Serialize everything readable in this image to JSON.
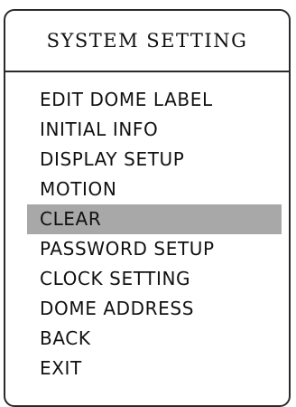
{
  "menu": {
    "title": "SYSTEM SETTING",
    "selected_item": "CLEAR",
    "items": [
      {
        "label": "EDIT  DOME  LABEL"
      },
      {
        "label": "INITIAL  INFO"
      },
      {
        "label": "DISPLAY  SETUP"
      },
      {
        "label": "MOTION"
      },
      {
        "label": "CLEAR"
      },
      {
        "label": "PASSWORD SETUP"
      },
      {
        "label": "CLOCK SETTING"
      },
      {
        "label": "DOME ADDRESS"
      },
      {
        "label": "BACK"
      },
      {
        "label": "EXIT"
      }
    ]
  },
  "colors": {
    "border": "#2a2a2a",
    "text": "#111111",
    "selection_highlight": "#a8a8a8",
    "background": "#ffffff"
  }
}
